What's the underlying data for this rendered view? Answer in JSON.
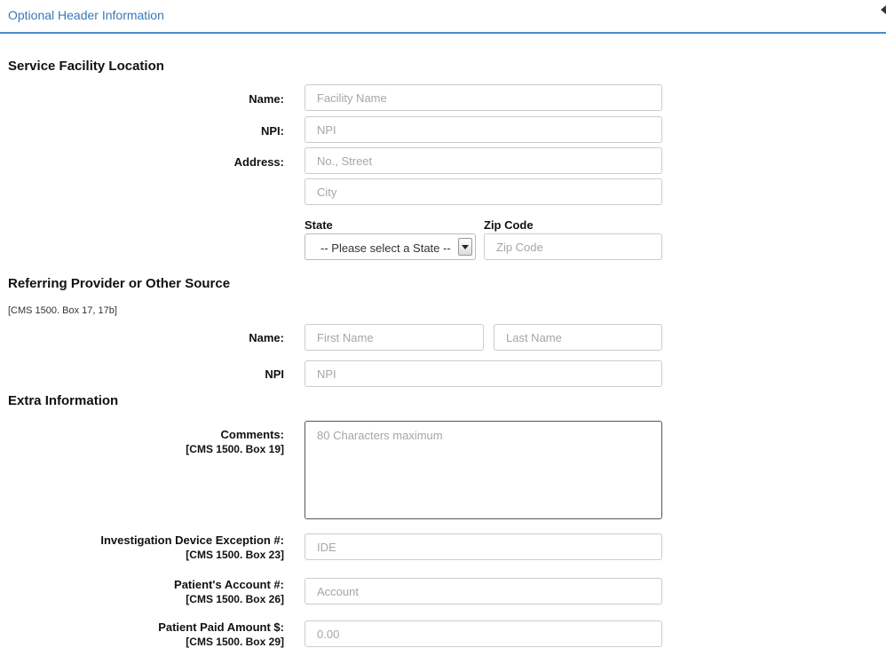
{
  "panel": {
    "title": "Optional Header Information"
  },
  "service_facility": {
    "title": "Service Facility Location",
    "name_label": "Name:",
    "name_placeholder": "Facility Name",
    "npi_label": "NPI:",
    "npi_placeholder": "NPI",
    "address_label": "Address:",
    "street_placeholder": "No., Street",
    "city_placeholder": "City",
    "state_label": "State",
    "state_selected": "-- Please select a State --",
    "zip_label": "Zip Code",
    "zip_placeholder": "Zip Code"
  },
  "referring": {
    "title": "Referring Provider or Other Source",
    "note": "[CMS 1500. Box 17, 17b]",
    "name_label": "Name:",
    "first_placeholder": "First Name",
    "last_placeholder": "Last Name",
    "npi_label": "NPI",
    "npi_placeholder": "NPI"
  },
  "extra": {
    "title": "Extra Information",
    "comments_label": "Comments:",
    "comments_sub": "[CMS 1500. Box 19]",
    "comments_placeholder": "80 Characters maximum",
    "ide_label": "Investigation Device Exception #:",
    "ide_sub": "[CMS 1500. Box 23]",
    "ide_placeholder": "IDE",
    "account_label": "Patient's Account #:",
    "account_sub": "[CMS 1500. Box 26]",
    "account_placeholder": "Account",
    "paid_label": "Patient Paid Amount $:",
    "paid_sub": "[CMS 1500. Box 29]",
    "paid_placeholder": "0.00"
  },
  "icons": {
    "collapse": "caret-left-icon",
    "dropdown": "caret-down-icon"
  },
  "colors": {
    "accent": "#3a78b6",
    "rule": "#4a8ecb"
  }
}
